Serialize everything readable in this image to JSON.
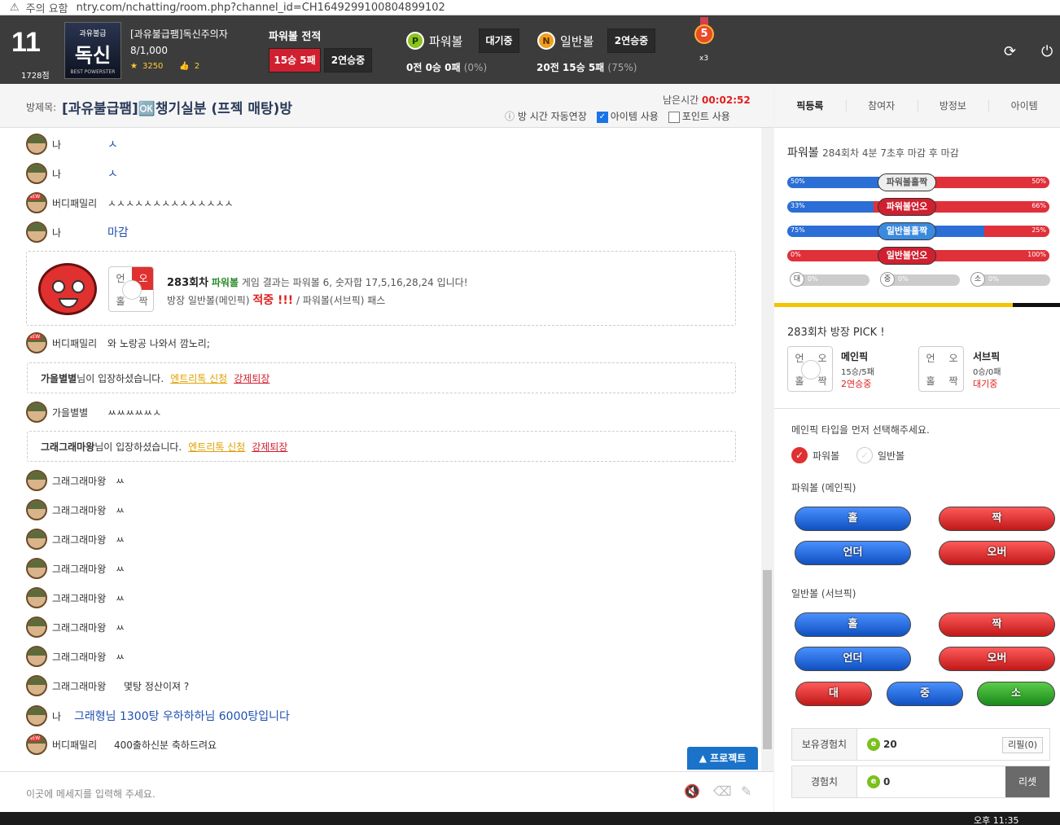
{
  "browser": {
    "warning": "주의 요함",
    "url": "ntry.com/nchatting/room.php?channel_id=CH1649299100804899102"
  },
  "user": {
    "level": "11",
    "points": "1728점",
    "badge_top": "과유불급",
    "badge_main": "독신",
    "badge_bottom": "BEST POWERSTER",
    "name": "[과유불급팸]독신주의자",
    "money": "8/1,000",
    "stars": "3250",
    "likes": "2"
  },
  "powerball_record": {
    "title": "파워볼 전적",
    "record": "15승 5패",
    "streak": "2연승중"
  },
  "games": [
    {
      "icon": "P",
      "name": "파워볼",
      "status": "대기중",
      "rec": "0전 0승 0패",
      "pct": "(0%)"
    },
    {
      "icon": "N",
      "name": "일반볼",
      "status": "2연승중",
      "rec": "20전 15승 5패",
      "pct": "(75%)"
    }
  ],
  "medal": {
    "num": "5",
    "mult": "x3"
  },
  "room": {
    "label": "방제목:",
    "name": "[과유불급팸]🆗챙기실분 (프젝 매탕)방",
    "remain_label": "남은시간",
    "remain": "00:02:52",
    "opt_auto": "방 시간 자동연장",
    "opt_item": "아이템 사용",
    "opt_point": "포인트 사용"
  },
  "chat": [
    {
      "nick": "나",
      "text": "ㅅ",
      "blue": true
    },
    {
      "nick": "나",
      "text": "ㅅ",
      "blue": true
    },
    {
      "nick": "버디패밀리",
      "text": "ㅅㅅㅅㅅㅅㅅㅅㅅㅅㅅㅅㅅㅅㅅ",
      "new": true
    },
    {
      "nick": "나",
      "text": "마감",
      "blue": true
    },
    {
      "nick": "버디패밀리",
      "text": "와 노랑공 나와서 깜노리;",
      "new": true
    },
    {
      "nick": "가을별별",
      "text": "ㅆㅆㅆㅆㅆㅅ"
    },
    {
      "nick": "그래그래마왕",
      "text": "ㅆ"
    },
    {
      "nick": "그래그래마왕",
      "text": "ㅆ"
    },
    {
      "nick": "그래그래마왕",
      "text": "ㅆ"
    },
    {
      "nick": "그래그래마왕",
      "text": "ㅆ"
    },
    {
      "nick": "그래그래마왕",
      "text": "ㅆ"
    },
    {
      "nick": "그래그래마왕",
      "text": "ㅆ"
    },
    {
      "nick": "그래그래마왕",
      "text": "ㅆ"
    },
    {
      "nick": "그래그래마왕",
      "text": "몇탕 정산이져 ?"
    },
    {
      "nick": "나",
      "text": "그래형님 1300탕 우하하하님 6000탕입니다",
      "blue": true
    },
    {
      "nick": "버디패밀리",
      "text": "400출하신분 축하드려요",
      "new": true
    }
  ],
  "result": {
    "round": "283회차",
    "game": "파워볼",
    "mid": "게임 결과는 파워볼 6, 숫자합 17,5,16,28,24 입니다!",
    "line2a": "방장 일반볼(메인픽)",
    "hit": "적중 !!!",
    "line2b": "/ 파워볼(서브픽)",
    "pass": "패스",
    "cells": [
      "언",
      "오",
      "홀",
      "짝"
    ]
  },
  "notices": [
    {
      "who": "가을별별",
      "msg": "님이 입장하셨습니다.",
      "l1": "엔트리톡 신청",
      "l2": "강제퇴장"
    },
    {
      "who": "그래그래마왕",
      "msg": "님이 입장하셨습니다.",
      "l1": "엔트리톡 신청",
      "l2": "강제퇴장"
    }
  ],
  "input": {
    "placeholder": "이곳에 메세지를 입력해 주세요.",
    "protect": "▲ 프로젝트"
  },
  "tabs": [
    "픽등록",
    "참여자",
    "방정보",
    "아이템"
  ],
  "pb_stats": {
    "title": "파워볼",
    "info": "284회차 4분 7초후 마감 후 마감",
    "rows": [
      {
        "left": "50%",
        "right": "50%",
        "label": "파워볼홀짝",
        "style": "gray",
        "blue": 0.5
      },
      {
        "left": "33%",
        "right": "66%",
        "label": "파워볼언오",
        "style": "red",
        "blue": 0.33
      },
      {
        "left": "75%",
        "right": "25%",
        "label": "일반볼홀짝",
        "style": "blue",
        "blue": 0.75
      },
      {
        "left": "0%",
        "right": "100%",
        "label": "일반볼언오",
        "style": "red",
        "blue": 0.0
      }
    ],
    "mini": [
      {
        "lb": "대",
        "pc": "0%"
      },
      {
        "lb": "중",
        "pc": "0%"
      },
      {
        "lb": "소",
        "pc": "0%"
      }
    ]
  },
  "pick": {
    "title": "283회차 방장 PICK !",
    "main": {
      "label": "메인픽",
      "rec": "15승/5패",
      "st": "2연승중"
    },
    "sub": {
      "label": "서브픽",
      "rec": "0승/0패",
      "st": "대기중"
    },
    "cells": [
      "언",
      "오",
      "홀",
      "짝"
    ]
  },
  "form": {
    "guide": "메인픽 타입을 먼저 선택해주세요.",
    "r1": "파워볼",
    "r2": "일반볼",
    "g1": "파워볼 (메인픽)",
    "g2": "일반볼 (서브픽)",
    "odd": "홀",
    "even": "짝",
    "under": "언더",
    "over": "오버",
    "big": "대",
    "mid": "중",
    "small": "소"
  },
  "exp": {
    "own_label": "보유경험치",
    "own_val": "20",
    "refill": "리필(0)",
    "exp_label": "경험치",
    "exp_val": "0",
    "reset": "리셋"
  },
  "taskbar": {
    "time": "오후 11:35"
  },
  "colors": {
    "accent_red": "#d02030",
    "accent_blue": "#2b6fd6",
    "streak_red": "#e02020"
  }
}
